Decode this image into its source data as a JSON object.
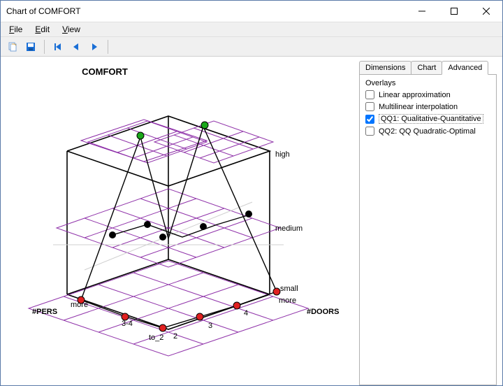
{
  "window": {
    "title": "Chart of COMFORT"
  },
  "menu": {
    "file": "File",
    "edit": "Edit",
    "view": "View"
  },
  "chart": {
    "title": "COMFORT",
    "z_levels": [
      "small",
      "medium",
      "high"
    ],
    "x_axis_label": "#DOORS",
    "y_axis_label": "#PERS",
    "x_ticks": [
      "2",
      "3",
      "4",
      "more"
    ],
    "y_ticks": [
      "to_2",
      "3-4",
      "more"
    ]
  },
  "tabs": {
    "dimensions": "Dimensions",
    "chart": "Chart",
    "advanced": "Advanced"
  },
  "overlays": {
    "group": "Overlays",
    "linear": "Linear approximation",
    "multilinear": "Multilinear interpolation",
    "qq1": "QQ1: Qualitative-Quantitative",
    "qq2": "QQ2: QQ Quadratic-Optimal",
    "checked": {
      "linear": false,
      "multilinear": false,
      "qq1": true,
      "qq2": false
    }
  }
}
